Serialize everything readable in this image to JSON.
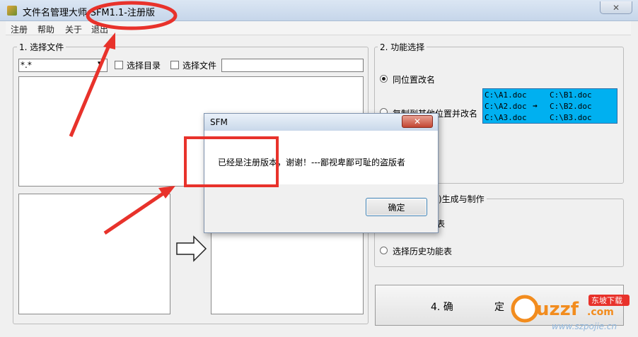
{
  "window": {
    "title": "文件名管理大师-SFM1.1-注册版",
    "close_glyph": "✕"
  },
  "menu": [
    "注册",
    "帮助",
    "关于",
    "退出"
  ],
  "section1": {
    "label": "1. 选择文件",
    "filter_value": "*.*",
    "filter_arrow": "▼",
    "select_dir_label": "选择目录",
    "select_file_label": "选择文件",
    "path_value": ""
  },
  "section2": {
    "label": "2. 功能选择",
    "option_same_location": "同位置改名",
    "option_copy_rename": "复制到其他位置并改名",
    "selected": "同位置改名",
    "preview": {
      "left": [
        "C:\\A1.doc",
        "C:\\A2.doc",
        "C:\\A3.doc"
      ],
      "right": [
        "C:\\B1.doc",
        "C:\\B2.doc",
        "C:\\B3.doc"
      ],
      "arrow": "→",
      "bg_color": "#00b0f0"
    }
  },
  "section3": {
    "label_partial": ")生成与制作",
    "option_partial": "表",
    "option_history": "选择历史功能表"
  },
  "confirm_button": {
    "label_left": "4. 确",
    "label_right": "定"
  },
  "dialog": {
    "title": "SFM",
    "close_glyph": "✕",
    "message": "已经是注册版本，谢谢！---鄙视卑鄙可耻的盗版者",
    "ok_label": "确定"
  },
  "colors": {
    "annotation_red": "#e8322b",
    "dialog_accent": "#3c7fb1"
  },
  "watermark": {
    "brand": "uzzf",
    "suffix": ".com",
    "badge": "东坡下载",
    "url": "www.szpojie.cn"
  },
  "icons": [
    "app-icon",
    "combo-arrow-icon",
    "arrow-right-icon",
    "close-icon"
  ]
}
